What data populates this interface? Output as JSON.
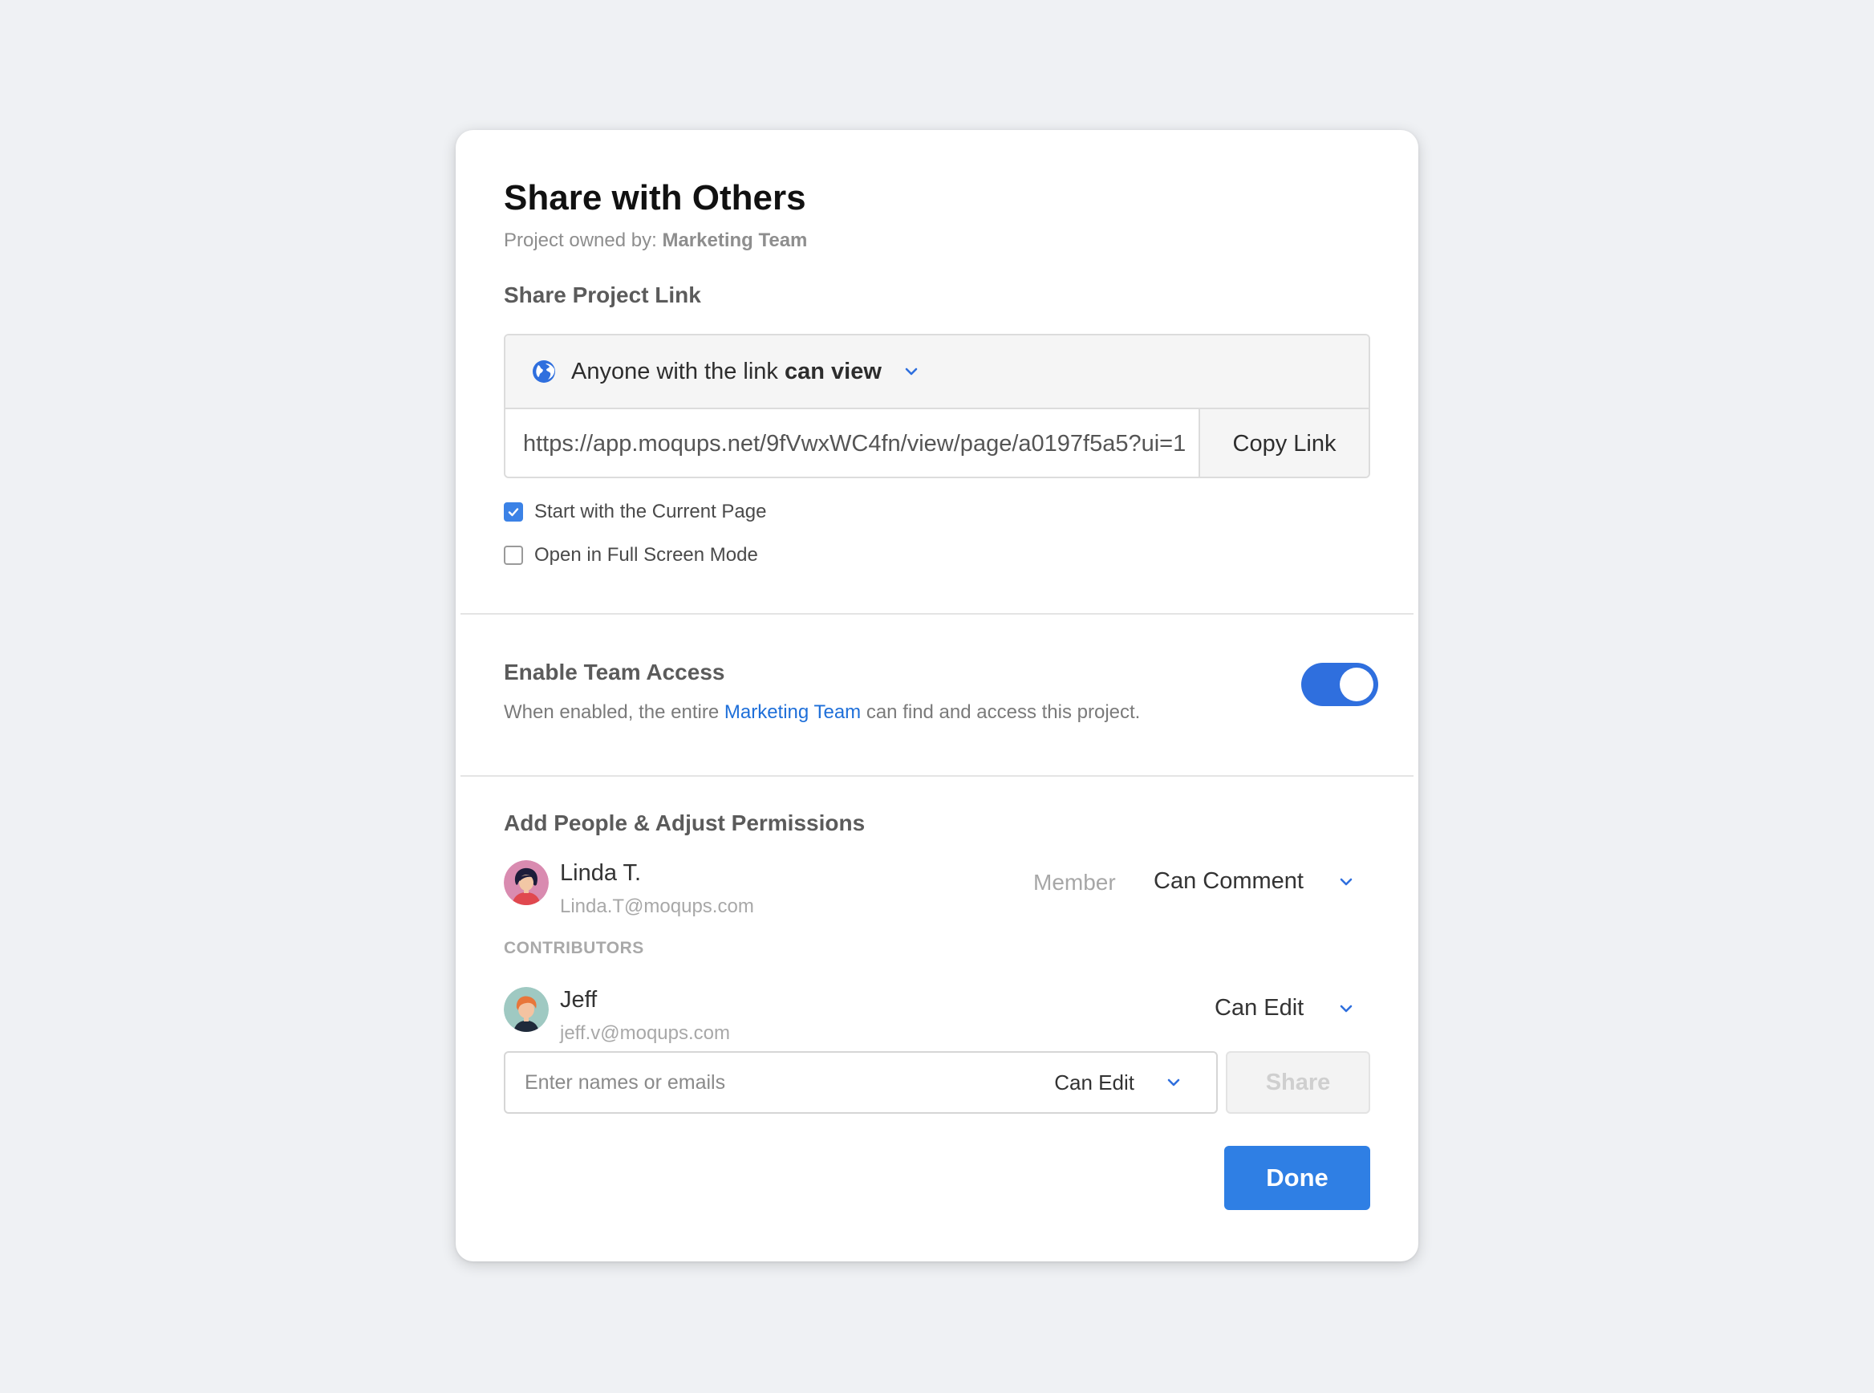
{
  "dialog": {
    "title": "Share with Others",
    "owner_prefix": "Project owned by:",
    "owner_name": "Marketing Team"
  },
  "share_link": {
    "section_title": "Share Project Link",
    "access_prefix": "Anyone with the link",
    "access_level": "can view",
    "url": "https://app.moqups.net/9fVwxWC4fn/view/page/a0197f5a5?ui=1",
    "copy_label": "Copy Link",
    "options": [
      {
        "label": "Start with the Current Page",
        "checked": true
      },
      {
        "label": "Open in Full Screen Mode",
        "checked": false
      }
    ]
  },
  "team_access": {
    "title": "Enable Team Access",
    "desc_before": "When enabled, the entire",
    "team_link": "Marketing Team",
    "desc_after": "can find and access this project.",
    "enabled": true
  },
  "people": {
    "section_title": "Add People & Adjust Permissions",
    "owner_person": {
      "name": "Linda T.",
      "email": "Linda.T@moqups.com",
      "role": "Member",
      "permission": "Can Comment"
    },
    "contributors_label": "CONTRIBUTORS",
    "contributors": [
      {
        "name": "Jeff",
        "email": "jeff.v@moqups.com",
        "permission": "Can Edit"
      }
    ],
    "invite": {
      "placeholder": "Enter names or emails",
      "permission": "Can Edit",
      "share_label": "Share"
    }
  },
  "footer": {
    "done_label": "Done"
  },
  "colors": {
    "accent": "#2f7fe4",
    "link": "#1e6fd9",
    "toggle_on": "#2f6fde",
    "background": "#eff1f4"
  },
  "icons": {
    "access": "globe-icon",
    "dropdown": "chevron-down-icon",
    "checkbox_checked": "check-icon"
  }
}
